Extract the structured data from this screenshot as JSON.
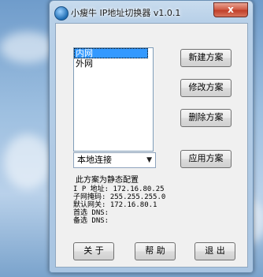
{
  "window": {
    "title": "小瘦牛 IP地址切换器 v1.0.1",
    "close_label": "x"
  },
  "profiles": {
    "items": [
      {
        "label": "内网",
        "selected": true
      },
      {
        "label": "外网",
        "selected": false
      }
    ]
  },
  "actions": {
    "new_label": "新建方案",
    "edit_label": "修改方案",
    "delete_label": "删除方案",
    "apply_label": "应用方案"
  },
  "adapter": {
    "selected": "本地连接"
  },
  "details": {
    "heading": "此方案为静态配置",
    "ip_label": "I P 地址:",
    "ip_value": "172.16.80.25",
    "mask_label": "子网掩码:",
    "mask_value": "255.255.255.0",
    "gateway_label": "默认网关:",
    "gateway_value": "172.16.80.1",
    "dns1_label": "首选 DNS:",
    "dns1_value": "",
    "dns2_label": "备选 DNS:",
    "dns2_value": ""
  },
  "footer": {
    "about_label": "关 于",
    "help_label": "帮 助",
    "exit_label": "退 出"
  },
  "colors": {
    "selection": "#3399ff",
    "close_button": "#c1402a"
  }
}
